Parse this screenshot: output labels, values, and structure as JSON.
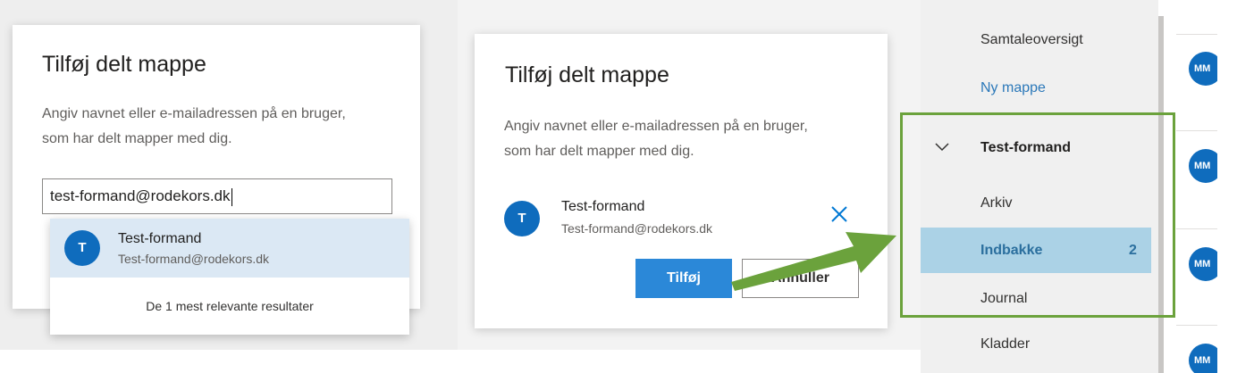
{
  "dialog_left": {
    "title": "Tilføj delt mappe",
    "description": "Angiv navnet eller e-mailadressen på en bruger, som har delt mapper med dig.",
    "input_value": "test-formand@rodekors.dk",
    "suggestion": {
      "avatar_initial": "T",
      "name": "Test-formand",
      "email": "Test-formand@rodekors.dk"
    },
    "suggestion_footer": "De 1 mest relevante resultater"
  },
  "dialog_right": {
    "title": "Tilføj delt mappe",
    "description": "Angiv navnet eller e-mailadressen på en bruger, som har delt mapper med dig.",
    "selected_person": {
      "avatar_initial": "T",
      "name": "Test-formand",
      "email": "Test-formand@rodekors.dk"
    },
    "remove_icon": "close-icon",
    "add_button": "Tilføj",
    "cancel_button": "Annuller"
  },
  "folder_pane": {
    "items": [
      {
        "label": "Samtaleoversigt"
      },
      {
        "label": "Ny mappe"
      },
      {
        "label": "Test-formand",
        "expanded": true
      },
      {
        "label": "Arkiv"
      },
      {
        "label": "Indbakke",
        "count": "2",
        "selected": true
      },
      {
        "label": "Journal"
      },
      {
        "label": "Kladder"
      }
    ]
  },
  "message_list": {
    "avatar_initials": [
      "MM",
      "MM",
      "MM",
      "MM"
    ]
  },
  "colors": {
    "accent_blue": "#0f6cbd",
    "primary_button": "#2b88d8",
    "selected_folder": "#abd2e6",
    "annotation_green": "#6ba23c"
  }
}
